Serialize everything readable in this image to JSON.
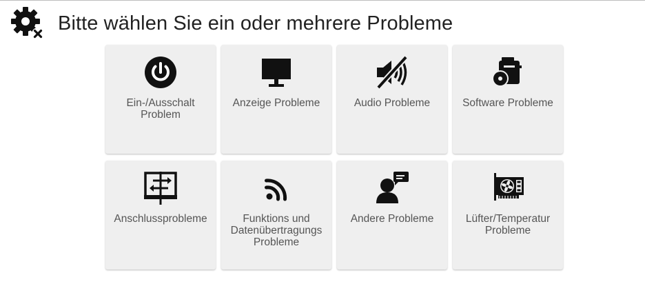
{
  "header": {
    "title": "Bitte wählen Sie ein oder mehrere Probleme",
    "icon": "gear-x-icon"
  },
  "tiles": [
    {
      "label": "Ein-/Ausschalt\nProblem",
      "icon": "power-icon"
    },
    {
      "label": "Anzeige Probleme",
      "icon": "monitor-icon"
    },
    {
      "label": "Audio Probleme",
      "icon": "speaker-muted-icon"
    },
    {
      "label": "Software Probleme",
      "icon": "software-disc-icon"
    },
    {
      "label": "Anschlussprobleme",
      "icon": "connection-transfer-icon"
    },
    {
      "label": "Funktions und\nDatenübertragungs\nProbleme",
      "icon": "rss-feed-icon"
    },
    {
      "label": "Andere Probleme",
      "icon": "user-chat-icon"
    },
    {
      "label": "Lüfter/Temperatur\nProbleme",
      "icon": "fan-card-icon"
    }
  ],
  "colors": {
    "tile_background": "#efefef",
    "icon": "#111111",
    "label": "#555555",
    "title": "#222222"
  }
}
